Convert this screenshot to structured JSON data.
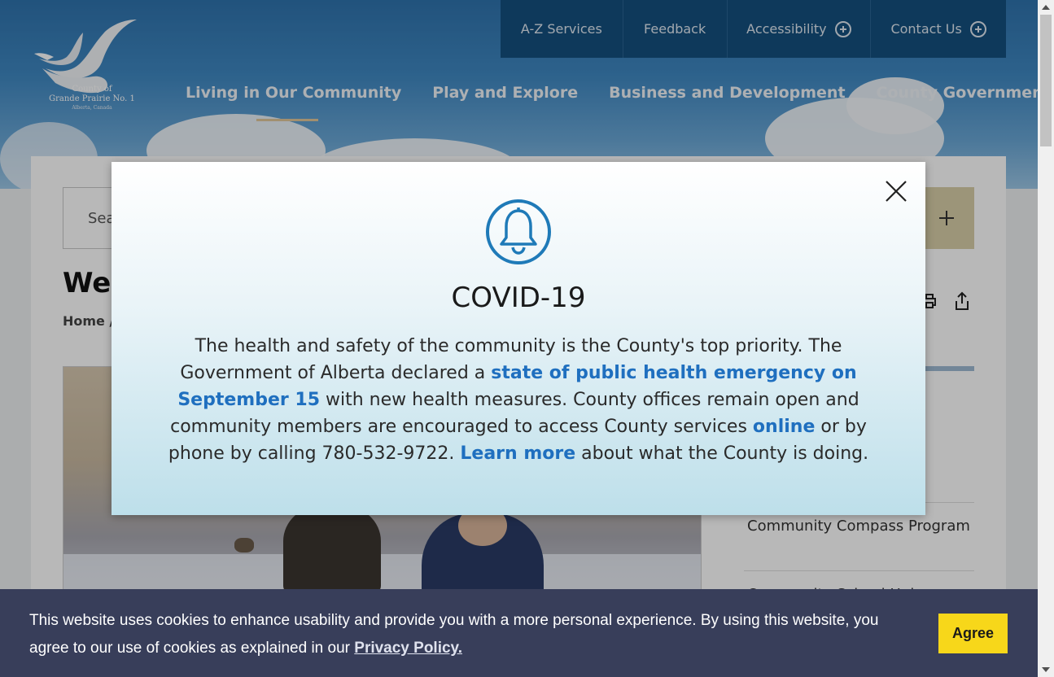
{
  "logo": {
    "line1": "County of",
    "line2": "Grande Prairie No. 1",
    "line3": "Alberta, Canada"
  },
  "utility_nav": [
    {
      "label": "A-Z Services",
      "icon": ""
    },
    {
      "label": "Feedback",
      "icon": ""
    },
    {
      "label": "Accessibility",
      "icon": "plus-circle-icon"
    },
    {
      "label": "Contact Us",
      "icon": "plus-circle-icon"
    }
  ],
  "main_nav": [
    {
      "label": "Living in Our Community"
    },
    {
      "label": "Play and Explore"
    },
    {
      "label": "Business and Development"
    },
    {
      "label": "County Government"
    }
  ],
  "search": {
    "placeholder_visible": "Sea"
  },
  "page": {
    "title_visible": "Wel",
    "breadcrumb_visible": "Home  /"
  },
  "sidebar_links": [
    {
      "label": "Community Compass Program"
    },
    {
      "label": "Community School Hub"
    }
  ],
  "modal": {
    "icon": "bell-icon",
    "title": "COVID-19",
    "body": {
      "p1": "The health and safety of the community is the County's top priority. The Government of Alberta declared a ",
      "link1": "state of public health emergency on September 15",
      "p2": " with new health measures. County offices remain open and community members are encouraged to access County services ",
      "link2": "online",
      "p3": " or by phone by calling 780-532-9722. ",
      "link3": "Learn more",
      "p4": " about what the County is doing."
    }
  },
  "cookie_bar": {
    "text": "This website uses cookies to enhance usability and provide you with a more personal experience. By using this website, you agree to our use of cookies as explained in our ",
    "link": "Privacy Policy.",
    "button": "Agree"
  },
  "colors": {
    "utility_bg": "#14507f",
    "link_blue": "#1f6fbf",
    "cookie_bg": "#383e5a",
    "agree_bg": "#f7d71a",
    "bell_blue": "#1f7ab8"
  }
}
